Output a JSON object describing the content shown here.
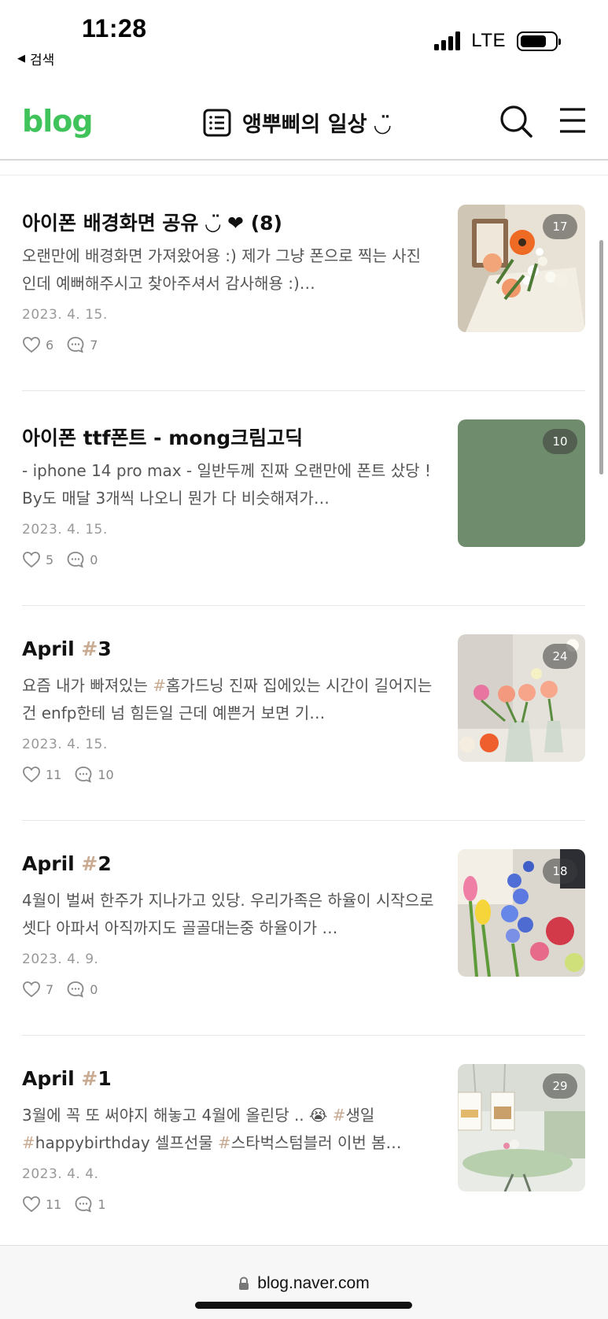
{
  "status_bar": {
    "time": "11:28",
    "back_label": "검색",
    "network": "LTE"
  },
  "header": {
    "logo": "blog",
    "blog_title": "앵뿌삐의 일상 ◡̈",
    "icons": [
      "list-icon",
      "search-icon",
      "menu-icon"
    ]
  },
  "posts": [
    {
      "title": "아이폰 배경화면 공유 ◡̈ ❤︎ (8)",
      "excerpt": "오랜만에 배경화면 가져왔어용 :) 제가 그냥 폰으로 찍는 사진인데 예뻐해주시고 찾아주셔서 감사해용 :)…",
      "date": "2023. 4. 15.",
      "likes": "6",
      "comments": "7",
      "image_count": "17"
    },
    {
      "title": "아이폰 ttf폰트 - mong크림고딕",
      "excerpt": "- iphone 14 pro max - 일반두께 진짜 오랜만에 폰트 샀당 ! By도 매달 3개씩 나오니 뭔가 다 비슷해져가…",
      "date": "2023. 4. 15.",
      "likes": "5",
      "comments": "0",
      "image_count": "10"
    },
    {
      "title_text": "April ",
      "title_hash": "#",
      "title_num": "3",
      "excerpt_a": "요즘 내가 빠져있는 ",
      "excerpt_hash": "#",
      "excerpt_b": "홈가드닝 진짜 집에있는 시간이 길어지는건 enfp한테 넘 힘든일 근데 예쁜거 보면 기…",
      "date": "2023. 4. 15.",
      "likes": "11",
      "comments": "10",
      "image_count": "24"
    },
    {
      "title_text": "April ",
      "title_hash": "#",
      "title_num": "2",
      "excerpt": "4월이 벌써 한주가 지나가고 있당. 우리가족은 하율이 시작으로 셋다 아파서 아직까지도 골골대는중 하율이가 …",
      "date": "2023. 4. 9.",
      "likes": "7",
      "comments": "0",
      "image_count": "18"
    },
    {
      "title_text": "April ",
      "title_hash": "#",
      "title_num": "1",
      "excerpt_a": "3월에 꼭 또 써야지 해놓고 4월에 올린당 .. 😭 ",
      "excerpt_hash1": "#",
      "excerpt_b": "생일 ",
      "excerpt_hash2": "#",
      "excerpt_c": "happybirthday 셀프선물 ",
      "excerpt_hash3": "#",
      "excerpt_d": "스타벅스텀블러 이번 봄…",
      "date": "2023. 4. 4.",
      "likes": "11",
      "comments": "1",
      "image_count": "29"
    }
  ],
  "browser": {
    "url": "blog.naver.com"
  },
  "colors": {
    "brand_green": "#3fc35a",
    "hashtag": "#c9ab93",
    "thumb_sage": "#6f8d6c"
  }
}
